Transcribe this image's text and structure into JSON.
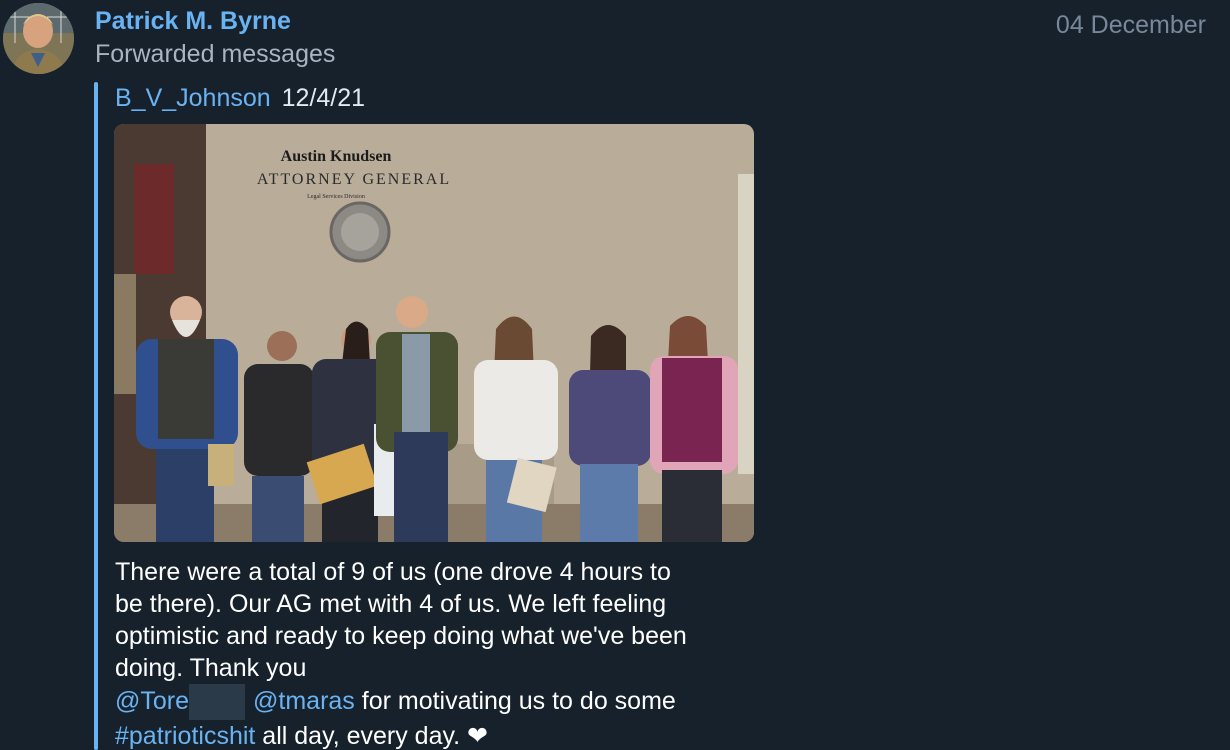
{
  "message": {
    "sender_name": "Patrick M. Byrne",
    "subtitle": "Forwarded messages",
    "date": "04 December",
    "forwarded_from": "B_V_Johnson",
    "forwarded_date": "12/4/21",
    "photo_sign": {
      "name": "Austin Knudsen",
      "title": "ATTORNEY GENERAL",
      "division": "Legal Services Division"
    },
    "text": {
      "line1": "There were a total of 9 of us (one drove 4 hours to",
      "line2": "be there). Our AG met with 4 of us. We left feeling",
      "line3": "optimistic and ready to keep doing what we've been",
      "line4": "doing. Thank you",
      "mention1": "@Tore",
      "mention2": "@tmaras",
      "line5_rest": " for motivating us to do some",
      "hashtag": "#patrioticshit",
      "line6_rest": " all day, every day. ❤"
    }
  },
  "colors": {
    "background": "#17212b",
    "accent": "#6ab3f3",
    "muted": "#a8b4c0",
    "date": "#78889a"
  },
  "icons": {
    "avatar": "profile-photo",
    "heart": "heart-emoji"
  }
}
